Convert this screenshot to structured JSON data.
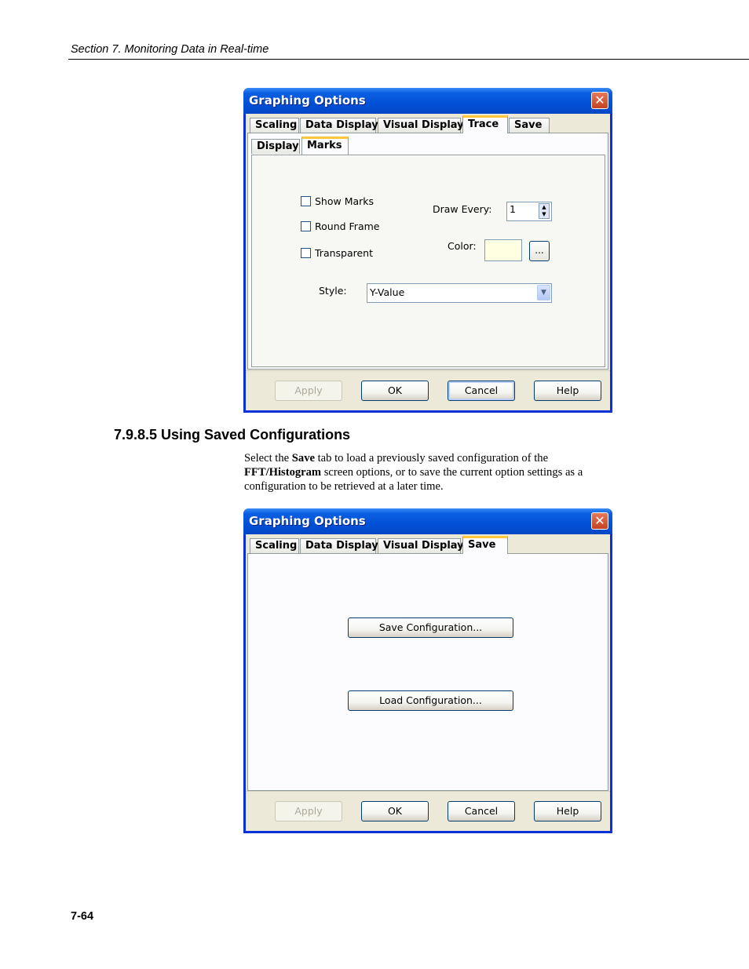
{
  "page": {
    "running_head": "Section 7.  Monitoring Data in Real-time",
    "page_number": "7-64",
    "section_heading": "7.9.8.5  Using Saved Configurations",
    "paragraph": {
      "part1": "Select the ",
      "bold1": "Save",
      "part2": " tab to load a previously saved configuration of the ",
      "bold2": "FFT/Histogram",
      "part3": " screen options, or to save the current option settings as a configuration to be retrieved at a later time."
    }
  },
  "dialog1": {
    "title": "Graphing Options",
    "close_glyph": "✕",
    "tabs": [
      "Scaling",
      "Data Display",
      "Visual Display",
      "Trace",
      "Save"
    ],
    "active_tab": "Trace",
    "subtabs": [
      "Display",
      "Marks"
    ],
    "active_subtab": "Marks",
    "checkboxes": [
      "Show Marks",
      "Round Frame",
      "Transparent"
    ],
    "draw_every_label": "Draw Every:",
    "draw_every_value": "1",
    "color_label": "Color:",
    "color_value": "#ffffe1",
    "color_button": "...",
    "style_label": "Style:",
    "style_value": "Y-Value",
    "buttons": {
      "apply": "Apply",
      "ok": "OK",
      "cancel": "Cancel",
      "help": "Help"
    }
  },
  "dialog2": {
    "title": "Graphing Options",
    "close_glyph": "✕",
    "tabs": [
      "Scaling",
      "Data Display",
      "Visual Display",
      "Save"
    ],
    "active_tab": "Save",
    "save_config_button": "Save Configuration...",
    "load_config_button": "Load Configuration...",
    "buttons": {
      "apply": "Apply",
      "ok": "OK",
      "cancel": "Cancel",
      "help": "Help"
    }
  }
}
